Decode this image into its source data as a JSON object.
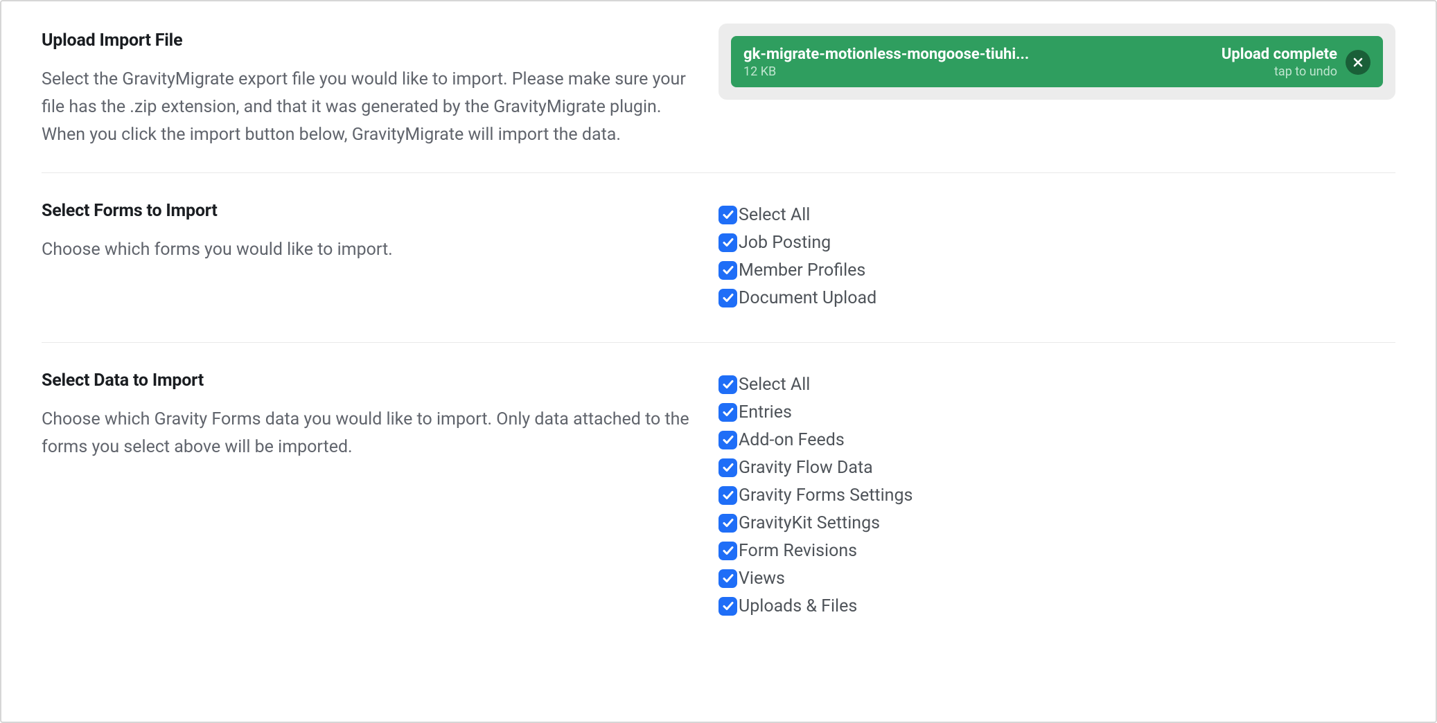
{
  "upload": {
    "section_title": "Upload Import File",
    "section_desc": "Select the GravityMigrate export file you would like to import. Please make sure your file has the .zip extension, and that it was generated by the GravityMigrate plugin. When you click the import button below, GravityMigrate will import the data.",
    "filename": "gk-migrate-motionless-mongoose-tiuhi...",
    "filesize": "12 KB",
    "status": "Upload complete",
    "undo_hint": "tap to undo"
  },
  "forms": {
    "section_title": "Select Forms to Import",
    "section_desc": "Choose which forms you would like to import.",
    "items": [
      {
        "label": "Select All",
        "checked": true
      },
      {
        "label": "Job Posting",
        "checked": true
      },
      {
        "label": "Member Profiles",
        "checked": true
      },
      {
        "label": "Document Upload",
        "checked": true
      }
    ]
  },
  "data": {
    "section_title": "Select Data to Import",
    "section_desc": "Choose which Gravity Forms data you would like to import. Only data attached to the forms you select above will be imported.",
    "items": [
      {
        "label": "Select All",
        "checked": true
      },
      {
        "label": "Entries",
        "checked": true
      },
      {
        "label": "Add-on Feeds",
        "checked": true
      },
      {
        "label": "Gravity Flow Data",
        "checked": true
      },
      {
        "label": "Gravity Forms Settings",
        "checked": true
      },
      {
        "label": "GravityKit Settings",
        "checked": true
      },
      {
        "label": "Form Revisions",
        "checked": true
      },
      {
        "label": "Views",
        "checked": true
      },
      {
        "label": "Uploads & Files",
        "checked": true
      }
    ]
  }
}
